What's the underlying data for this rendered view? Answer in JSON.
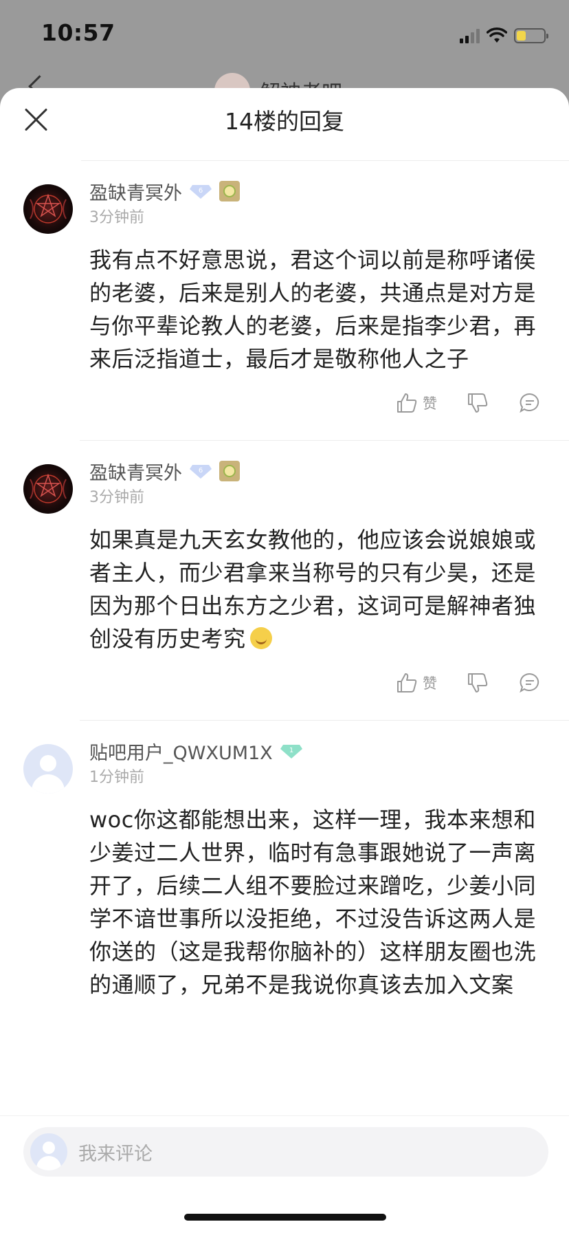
{
  "status_bar": {
    "time": "10:57",
    "battery_level": 0.35,
    "battery_color": "#f2d64b"
  },
  "background_nav": {
    "title_partial": "解神者吧"
  },
  "sheet": {
    "title": "14楼的回复"
  },
  "replies": [
    {
      "user": "盈缺青冥外",
      "level": "6",
      "time": "3分钟前",
      "text": "我有点不好意思说，君这个词以前是称呼诸侯的老婆，后来是别人的老婆，共通点是对方是与你平辈论教人的老婆，后来是指李少君，再来后泛指道士，最后才是敬称他人之子",
      "actions": {
        "like": "赞"
      }
    },
    {
      "user": "盈缺青冥外",
      "level": "6",
      "time": "3分钟前",
      "text": "如果真是九天玄女教他的，他应该会说娘娘或者主人，而少君拿来当称号的只有少昊，还是因为那个日出东方之少君，这词可是解神者独创没有历史考究",
      "actions": {
        "like": "赞"
      }
    },
    {
      "user": "贴吧用户_QWXUM1X",
      "level": "1",
      "time": "1分钟前",
      "text": "woc你这都能想出来，这样一理，我本来想和少姜过二人世界，临时有急事跟她说了一声离开了，后续二人组不要脸过来蹭吃，少姜小同学不谙世事所以没拒绝，不过没告诉这两人是你送的（这是我帮你脑补的）这样朋友圈也洗的通顺了，兄弟不是我说你真该去加入文案"
    }
  ],
  "input": {
    "placeholder": "我来评论"
  },
  "colors": {
    "level_blue": "#c9d6f7",
    "level_green": "#8ee0c8"
  }
}
